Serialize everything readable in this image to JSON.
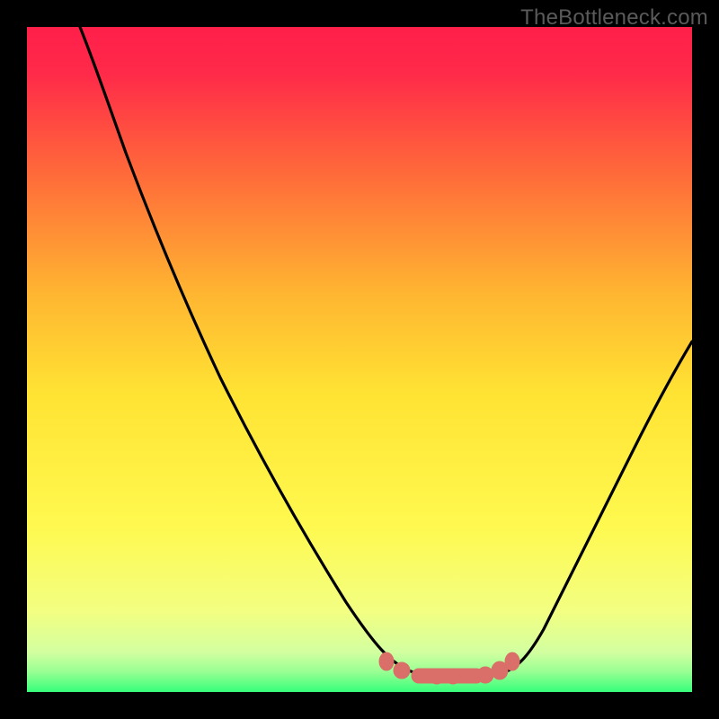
{
  "watermark": "TheBottleneck.com",
  "colors": {
    "page_bg": "#000000",
    "curve": "#000000",
    "optimal_marker": "#d96f68",
    "watermark": "#5a5a5a",
    "gradient_top": "#ff1f4a",
    "gradient_mid_upper": "#ff8a2a",
    "gradient_mid": "#ffe333",
    "gradient_lower": "#f7ff8a",
    "gradient_bottom": "#36ff7a"
  },
  "chart_data": {
    "type": "line",
    "title": "",
    "xlabel": "",
    "ylabel": "",
    "xlim": [
      0,
      100
    ],
    "ylim": [
      0,
      100
    ],
    "grid": false,
    "legend": false,
    "description": "V-shaped bottleneck curve over a vertical red-to-green gradient background. Lowest point (optimal region) lies roughly between x≈55 and x≈72 at y≈3. Left arm rises steeply to y≈100 at x≈0–8; right arm rises to y≈51 at x≈100.",
    "series": [
      {
        "name": "bottleneck-curve",
        "x": [
          8,
          12,
          17,
          22,
          27,
          32,
          37,
          42,
          47,
          52,
          55,
          58,
          62,
          66,
          70,
          72,
          76,
          82,
          88,
          94,
          100
        ],
        "y": [
          100,
          90,
          80,
          69,
          58,
          48,
          38,
          28,
          19,
          11,
          7,
          4,
          3,
          3,
          3,
          4,
          9,
          18,
          28,
          39,
          51
        ]
      }
    ],
    "optimal_range_x": [
      55,
      72
    ],
    "optimal_marker_points_x": [
      55,
      58,
      62,
      64,
      66,
      68,
      70,
      72
    ],
    "optimal_marker_y": 3
  }
}
